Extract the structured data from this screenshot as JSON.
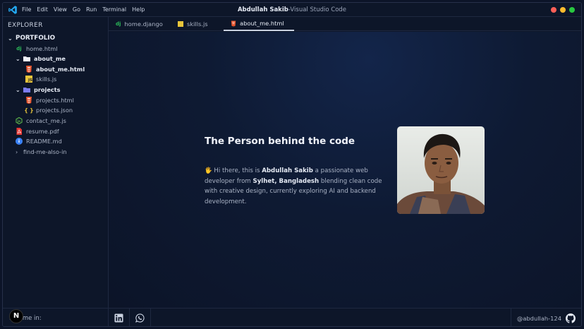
{
  "titlebar": {
    "menu": [
      "File",
      "Edit",
      "View",
      "Go",
      "Run",
      "Terminal",
      "Help"
    ],
    "title_name": "Abdullah Sakib",
    "title_suffix": "-Visual Studio Code",
    "dot_colors": [
      "#ff5f57",
      "#febc2e",
      "#28c840"
    ]
  },
  "sidebar": {
    "title": "EXPLORER",
    "root": "PORTFOLIO",
    "items": [
      {
        "label": "home.html",
        "icon": "django-icon"
      },
      {
        "label": "about_me",
        "icon": "folder-icon"
      },
      {
        "label": "about_me.html",
        "icon": "html-icon"
      },
      {
        "label": "skills.js",
        "icon": "js-icon"
      },
      {
        "label": "projects",
        "icon": "folder-icon"
      },
      {
        "label": "projects.html",
        "icon": "html-icon"
      },
      {
        "label": "projects.json",
        "icon": "json-icon"
      },
      {
        "label": "contact_me.js",
        "icon": "node-icon"
      },
      {
        "label": "resume.pdf",
        "icon": "pdf-icon"
      },
      {
        "label": "README.md",
        "icon": "info-icon"
      },
      {
        "label": "find-me-also-in",
        "icon": "chevron-right-icon"
      }
    ]
  },
  "tabs": [
    {
      "label": "home.django",
      "icon": "django-icon"
    },
    {
      "label": "skills.js",
      "icon": "js-icon"
    },
    {
      "label": "about_me.html",
      "icon": "html-icon",
      "active": true
    }
  ],
  "editor": {
    "heading": "The Person behind the code",
    "bio_emoji": "🖐",
    "bio_1": " Hi there, this is ",
    "bio_name": "Abdullah Sakib",
    "bio_2": " a passionate web developer from ",
    "bio_place": "Sylhet, Bangladesh",
    "bio_3": " blending clean code with creative design, currently exploring AI and backend development."
  },
  "footer": {
    "find_label": "find me in:",
    "badge": "N",
    "socials": [
      "linkedin-icon",
      "whatsapp-icon"
    ],
    "handle": "@abdullah-124"
  }
}
